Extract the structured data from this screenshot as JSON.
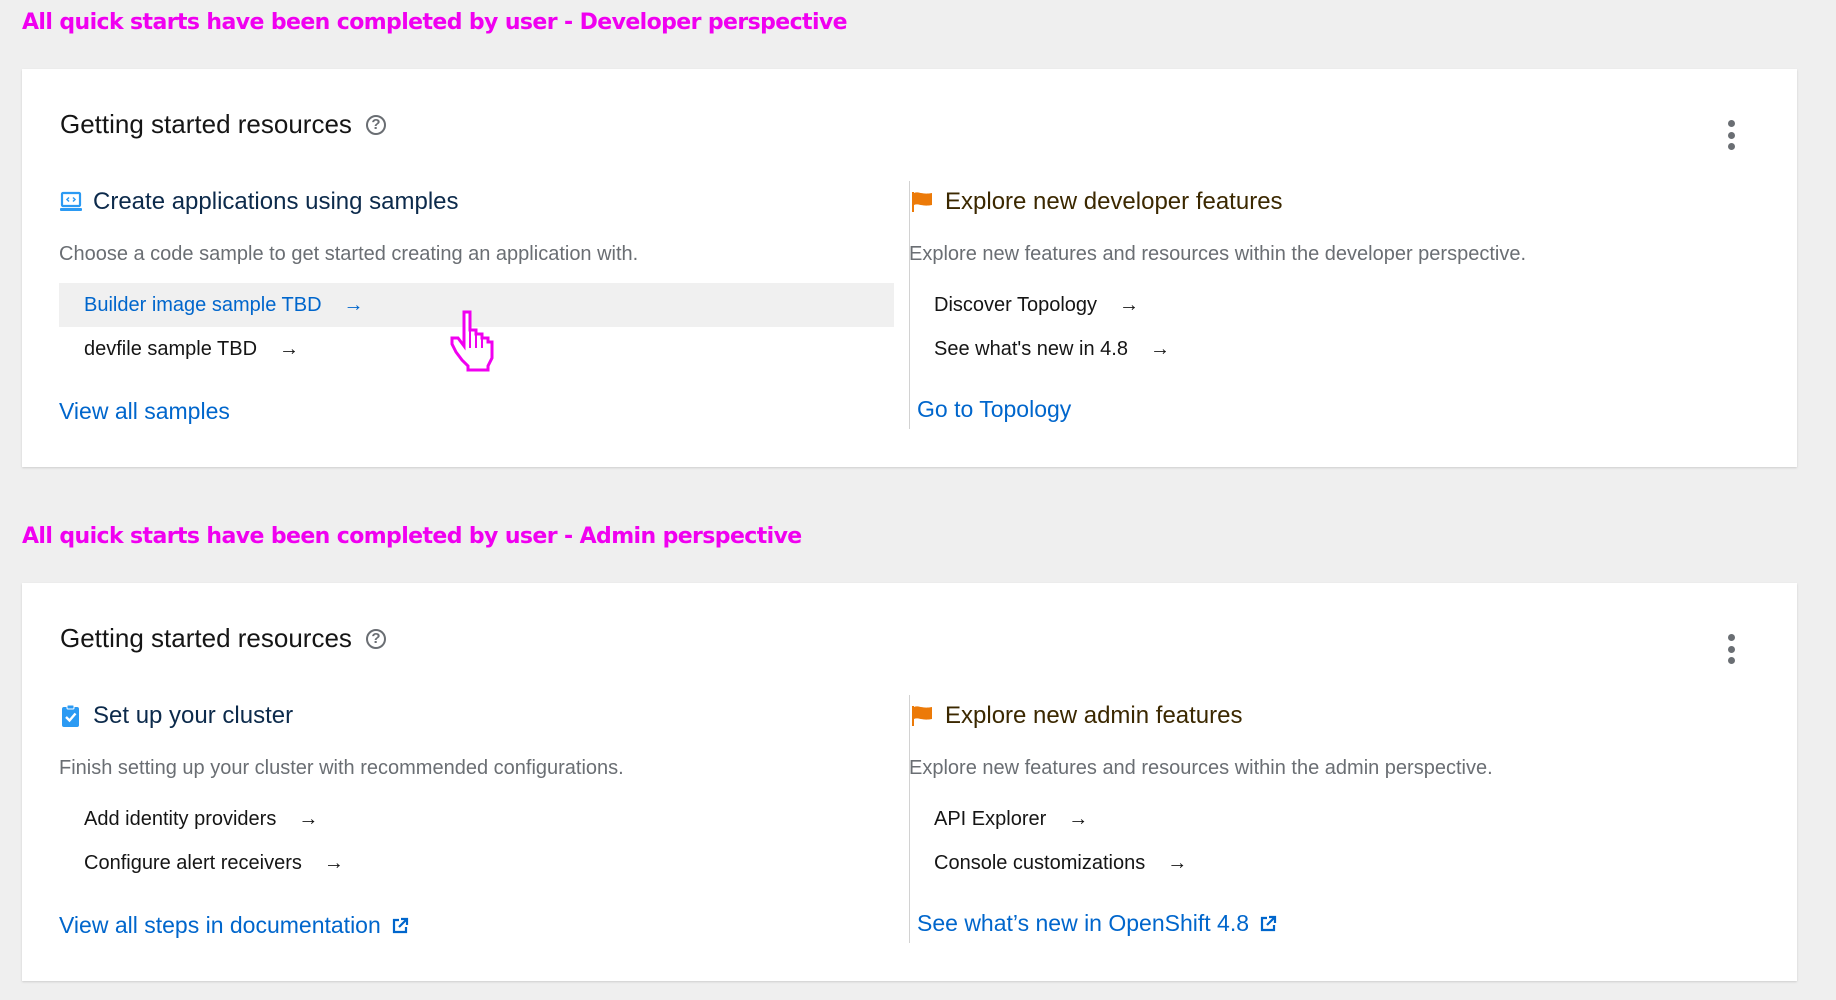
{
  "annotations": {
    "developer": "All quick starts have been completed by user - Developer perspective",
    "admin": "All quick starts have been completed by user - Admin perspective"
  },
  "developer_card": {
    "title": "Getting started resources",
    "help_icon": "question-circle-icon",
    "menu_icon": "kebab-menu-icon",
    "left": {
      "icon": "laptop-code-icon",
      "heading": "Create applications using samples",
      "description": "Choose a code sample to get started creating an application with.",
      "items": [
        {
          "label": "Builder image sample TBD",
          "arrow": "→",
          "hovered": true
        },
        {
          "label": "devfile sample TBD",
          "arrow": "→",
          "hovered": false
        }
      ],
      "footer_link": "View all samples"
    },
    "right": {
      "icon": "flag-icon",
      "heading": "Explore new developer features",
      "description": "Explore new features and resources within the developer perspective.",
      "items": [
        {
          "label": "Discover Topology",
          "arrow": "→"
        },
        {
          "label": "See what's new in 4.8",
          "arrow": "→"
        }
      ],
      "footer_link": "Go to Topology"
    }
  },
  "admin_card": {
    "title": "Getting started resources",
    "help_icon": "question-circle-icon",
    "menu_icon": "kebab-menu-icon",
    "left": {
      "icon": "clipboard-check-icon",
      "heading": "Set up your cluster",
      "description": "Finish setting up your cluster with recommended configurations.",
      "items": [
        {
          "label": "Add identity providers",
          "arrow": "→"
        },
        {
          "label": "Configure alert receivers",
          "arrow": "→"
        }
      ],
      "footer_link": "View all steps in documentation",
      "footer_icon": "external-link-icon"
    },
    "right": {
      "icon": "flag-icon",
      "heading": "Explore new admin features",
      "description": "Explore new features and resources within the admin perspective.",
      "items": [
        {
          "label": "API Explorer",
          "arrow": "→"
        },
        {
          "label": "Console customizations",
          "arrow": "→"
        }
      ],
      "footer_link": "See what’s new in OpenShift 4.8",
      "footer_icon": "external-link-icon"
    }
  },
  "colors": {
    "annotation": "#f000f0",
    "link": "#0066cc",
    "flag": "#ec7a08",
    "icon_blue": "#2b9af3",
    "background": "#efefef"
  }
}
